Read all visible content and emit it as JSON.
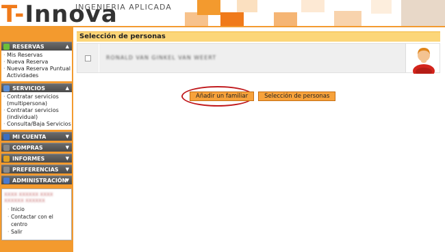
{
  "header": {
    "logo_t": "T-",
    "logo_rest": "Innova",
    "tagline": "INGENIERIA APLICADA"
  },
  "sidebar": {
    "sections": [
      {
        "title": "RESERVAS",
        "icon": "calendar-icon",
        "expanded": true,
        "items": [
          "Mis Reservas",
          "Nueva Reserva",
          "Nueva Reserva Puntual Actividades"
        ]
      },
      {
        "title": "SERVICIOS",
        "icon": "list-icon",
        "expanded": true,
        "items": [
          "Contratar servicios (multipersona)",
          "Contratar servicios (individual)",
          "Consulta/Baja Servicios"
        ]
      },
      {
        "title": "MI CUENTA",
        "icon": "user-account-icon",
        "expanded": false,
        "items": []
      },
      {
        "title": "COMPRAS",
        "icon": "cart-icon",
        "expanded": false,
        "items": []
      },
      {
        "title": "INFORMES",
        "icon": "report-icon",
        "expanded": false,
        "items": []
      },
      {
        "title": "PREFERENCIAS",
        "icon": "tools-icon",
        "expanded": false,
        "items": []
      },
      {
        "title": "ADMINISTRACIÓN",
        "icon": "admin-icon",
        "expanded": false,
        "items": []
      }
    ],
    "user_box": {
      "name": "XXXX XXXXXX XXXX XXXXXX XXXXXX",
      "links": [
        "Inicio",
        "Contactar con el centro",
        "Salir"
      ]
    }
  },
  "main": {
    "title": "Selección de personas",
    "person": {
      "name": "RONALD VAN GINKEL VAN WEERT",
      "selected": false
    },
    "buttons": {
      "add_family": "Añadir un familiar",
      "select_persons": "Selección de personas"
    }
  },
  "colors": {
    "accent": "#f39a2e",
    "title_bar": "#fcd679",
    "button": "#f7a23b",
    "highlight_ring": "#c0181c"
  }
}
